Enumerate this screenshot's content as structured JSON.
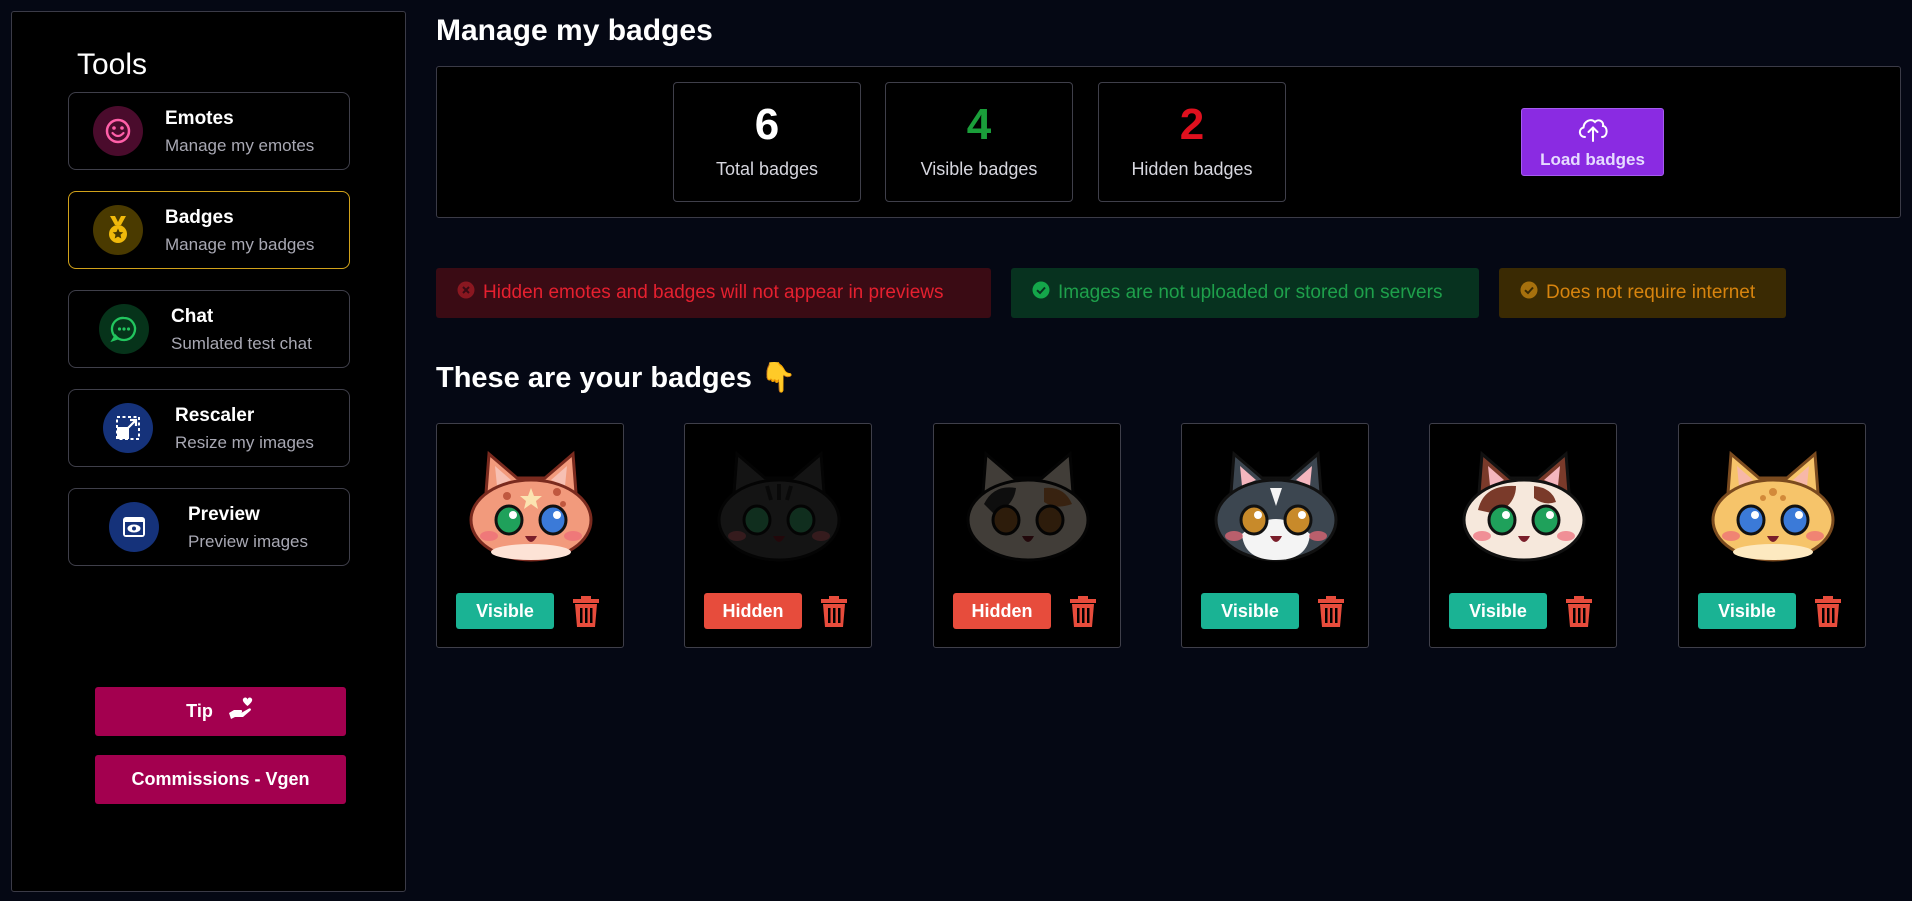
{
  "sidebar": {
    "title": "Tools",
    "items": [
      {
        "label": "Emotes",
        "sub": "Manage my emotes",
        "icon": "smiley-icon",
        "active": false
      },
      {
        "label": "Badges",
        "sub": "Manage my badges",
        "icon": "medal-icon",
        "active": true
      },
      {
        "label": "Chat",
        "sub": "Sumlated test chat",
        "icon": "chat-bubble-icon",
        "active": false
      },
      {
        "label": "Rescaler",
        "sub": "Resize my images",
        "icon": "resize-icon",
        "active": false
      },
      {
        "label": "Preview",
        "sub": "Preview images",
        "icon": "preview-eye-icon",
        "active": false
      }
    ],
    "tip_label": "Tip",
    "commissions_label": "Commissions - Vgen"
  },
  "main": {
    "title": "Manage my badges",
    "stats": {
      "total": {
        "value": "6",
        "label": "Total badges"
      },
      "visible": {
        "value": "4",
        "label": "Visible badges"
      },
      "hidden": {
        "value": "2",
        "label": "Hidden badges"
      }
    },
    "load_label": "Load badges",
    "notices": {
      "hidden": "Hidden emotes and badges will not appear in previews",
      "privacy": "Images are not uploaded or stored on servers",
      "offline": "Does not require internet"
    },
    "section_title": "These are your badges 👇",
    "badges": [
      {
        "status": "Visible",
        "cat": "orange-spotted-cat"
      },
      {
        "status": "Hidden",
        "cat": "black-tabby-cat"
      },
      {
        "status": "Hidden",
        "cat": "calico-cat"
      },
      {
        "status": "Visible",
        "cat": "gray-white-cat"
      },
      {
        "status": "Visible",
        "cat": "brown-white-cat"
      },
      {
        "status": "Visible",
        "cat": "yellow-cat"
      }
    ]
  },
  "colors": {
    "visible": "#1ab394",
    "hidden": "#e74c3c",
    "accent_purple": "#8a2be2",
    "tip_pink": "#a3004f",
    "active_gold": "#d1a21a"
  }
}
